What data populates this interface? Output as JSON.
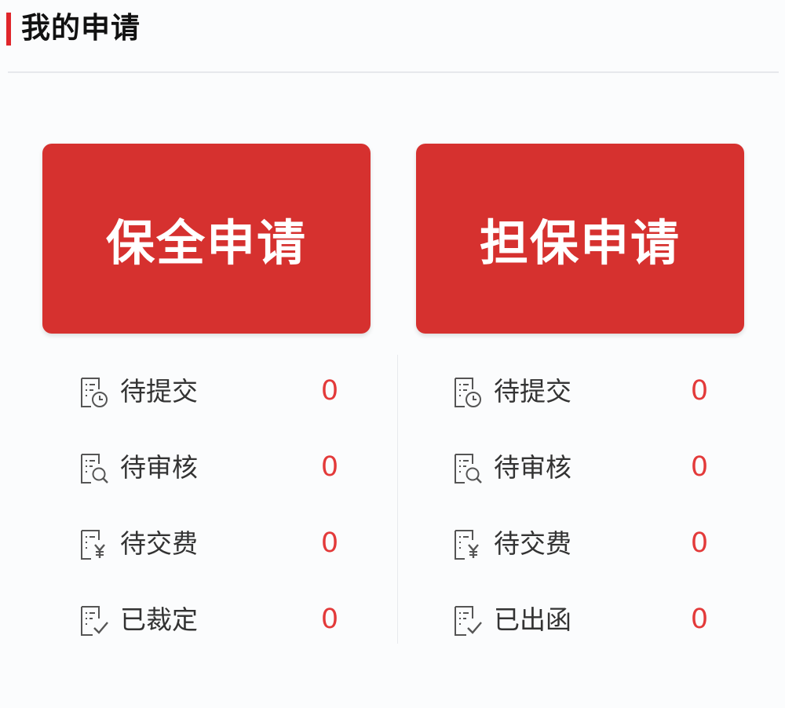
{
  "header": {
    "title": "我的申请",
    "accent_color": "#e0262b"
  },
  "colors": {
    "button_bg": "#d6312f",
    "count_color": "#e33a3a"
  },
  "panels": [
    {
      "button_label": "保全申请",
      "items": [
        {
          "label": "待提交",
          "count": "0",
          "icon": "document-clock-icon"
        },
        {
          "label": "待审核",
          "count": "0",
          "icon": "document-search-icon"
        },
        {
          "label": "待交费",
          "count": "0",
          "icon": "document-yen-icon"
        },
        {
          "label": "已裁定",
          "count": "0",
          "icon": "document-check-icon"
        }
      ]
    },
    {
      "button_label": "担保申请",
      "items": [
        {
          "label": "待提交",
          "count": "0",
          "icon": "document-clock-icon"
        },
        {
          "label": "待审核",
          "count": "0",
          "icon": "document-search-icon"
        },
        {
          "label": "待交费",
          "count": "0",
          "icon": "document-yen-icon"
        },
        {
          "label": "已出函",
          "count": "0",
          "icon": "document-check-icon"
        }
      ]
    }
  ]
}
